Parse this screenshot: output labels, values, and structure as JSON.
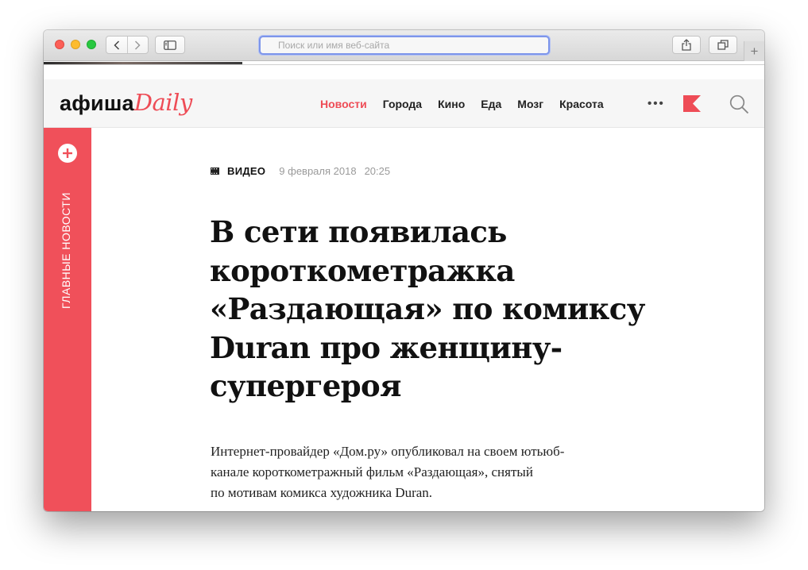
{
  "browser": {
    "address_placeholder": "Поиск или имя веб-сайта",
    "newtab_symbol": "+"
  },
  "header": {
    "logo_part1": "афиша",
    "logo_part2": "Daily",
    "nav": [
      "Новости",
      "Города",
      "Кино",
      "Еда",
      "Мозг",
      "Красота"
    ],
    "active_nav": "Новости",
    "more": "•••",
    "accent_color": "#ee4c56"
  },
  "sidebar": {
    "label": "ГЛАВНЫЕ НОВОСТИ",
    "color": "#f0505a"
  },
  "article": {
    "category": "ВИДЕО",
    "date": "9 февраля 2018",
    "time": "20:25",
    "headline": "В сети появилась короткометражка «Раздающая» по комиксу Duran про женщину-супергероя",
    "lead_lines": [
      "Интернет-провайдер «Дом.ру» опубликовал на своем ютьюб-",
      "канале короткометражный фильм «Раздающая», снятый",
      "по мотивам комикса художника Duran."
    ]
  }
}
